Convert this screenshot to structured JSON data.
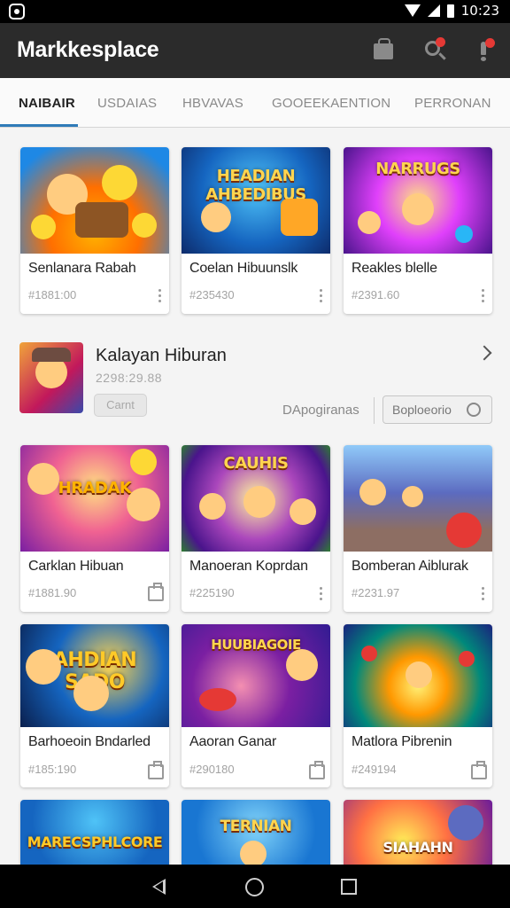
{
  "status": {
    "time": "10:23"
  },
  "app": {
    "title": "Markkesplace"
  },
  "tabs": [
    {
      "label": "NAIBAIR",
      "active": true
    },
    {
      "label": "USDAIAS",
      "active": false
    },
    {
      "label": "HBVAVAS",
      "active": false
    },
    {
      "label": "GOOEEKAENTION",
      "active": false
    },
    {
      "label": "PERRONAN",
      "active": false
    }
  ],
  "row1": [
    {
      "title": "Senlanara Rabah",
      "price": "#1881:00",
      "art": "",
      "action": "menu-icon"
    },
    {
      "title": "Coelan Hibuunslk",
      "price": "#235430",
      "art": "HEADIAN AHBEDIBUS",
      "action": "menu-icon"
    },
    {
      "title": "Reakles blelle",
      "price": "#2391.60",
      "art": "NARRUGS",
      "action": "menu-icon"
    }
  ],
  "featured": {
    "title": "Kalayan Hiburan",
    "subtitle": "2298:29.88",
    "chip": "Carnt",
    "link": "DApogiranas",
    "button": "Boploeorio"
  },
  "row2": [
    {
      "title": "Carklan Hibuan",
      "price": "#1881.90",
      "art": "HRADAK",
      "action": "cart-icon"
    },
    {
      "title": "Manoeran Koprdan",
      "price": "#225190",
      "art": "CAUHIS",
      "action": "menu-icon"
    },
    {
      "title": "Bomberan Aiblurak",
      "price": "#2231.97",
      "art": "",
      "action": "menu-icon"
    }
  ],
  "row3": [
    {
      "title": "Barhoeoin Bndarled",
      "price": "#185:190",
      "art": "AHDIAN SADO",
      "action": "cart-icon"
    },
    {
      "title": "Aaoran Ganar",
      "price": "#290180",
      "art": "HUUBIAGOIE",
      "action": "cart-icon"
    },
    {
      "title": "Matlora Pibrenin",
      "price": "#249194",
      "art": "",
      "action": "cart-icon"
    }
  ],
  "row4": [
    {
      "art": "MARECSPHLCORE"
    },
    {
      "art": "TERNIAN"
    },
    {
      "art": "SIAHAHN"
    }
  ],
  "colors": {
    "accent": "#2f7bb8",
    "appbar": "#2b2b2b",
    "badge": "#e53935"
  }
}
